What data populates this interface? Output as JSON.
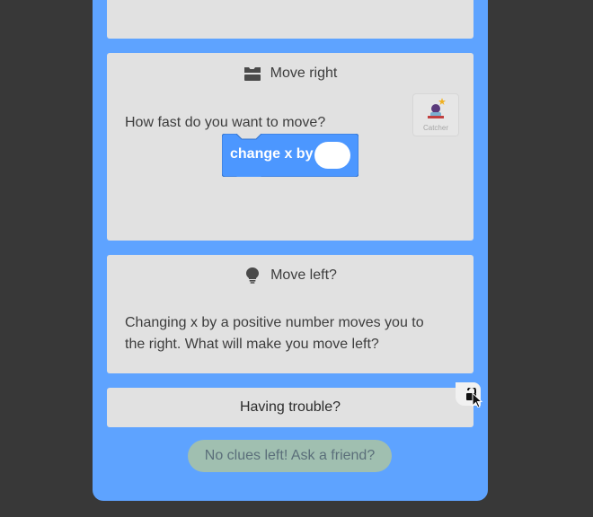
{
  "cards": {
    "move_right": {
      "title": "Move right",
      "icon": "blocks-icon",
      "text": "How fast do you want to move?",
      "block": {
        "label": "change x by",
        "color": "#4c97ff"
      },
      "sprite": {
        "name": "Catcher"
      }
    },
    "move_left": {
      "title": "Move left?",
      "icon": "lightbulb-icon",
      "text": "Changing x by a positive number moves you to the right. What will make you move left?"
    },
    "trouble": {
      "title": "Having trouble?"
    }
  },
  "footer": {
    "button_label": "No clues left! Ask a friend?"
  },
  "colors": {
    "background": "#383838",
    "panel": "#5ea3ff",
    "card": "#e1e1e1",
    "button": "#a0bfb0"
  }
}
